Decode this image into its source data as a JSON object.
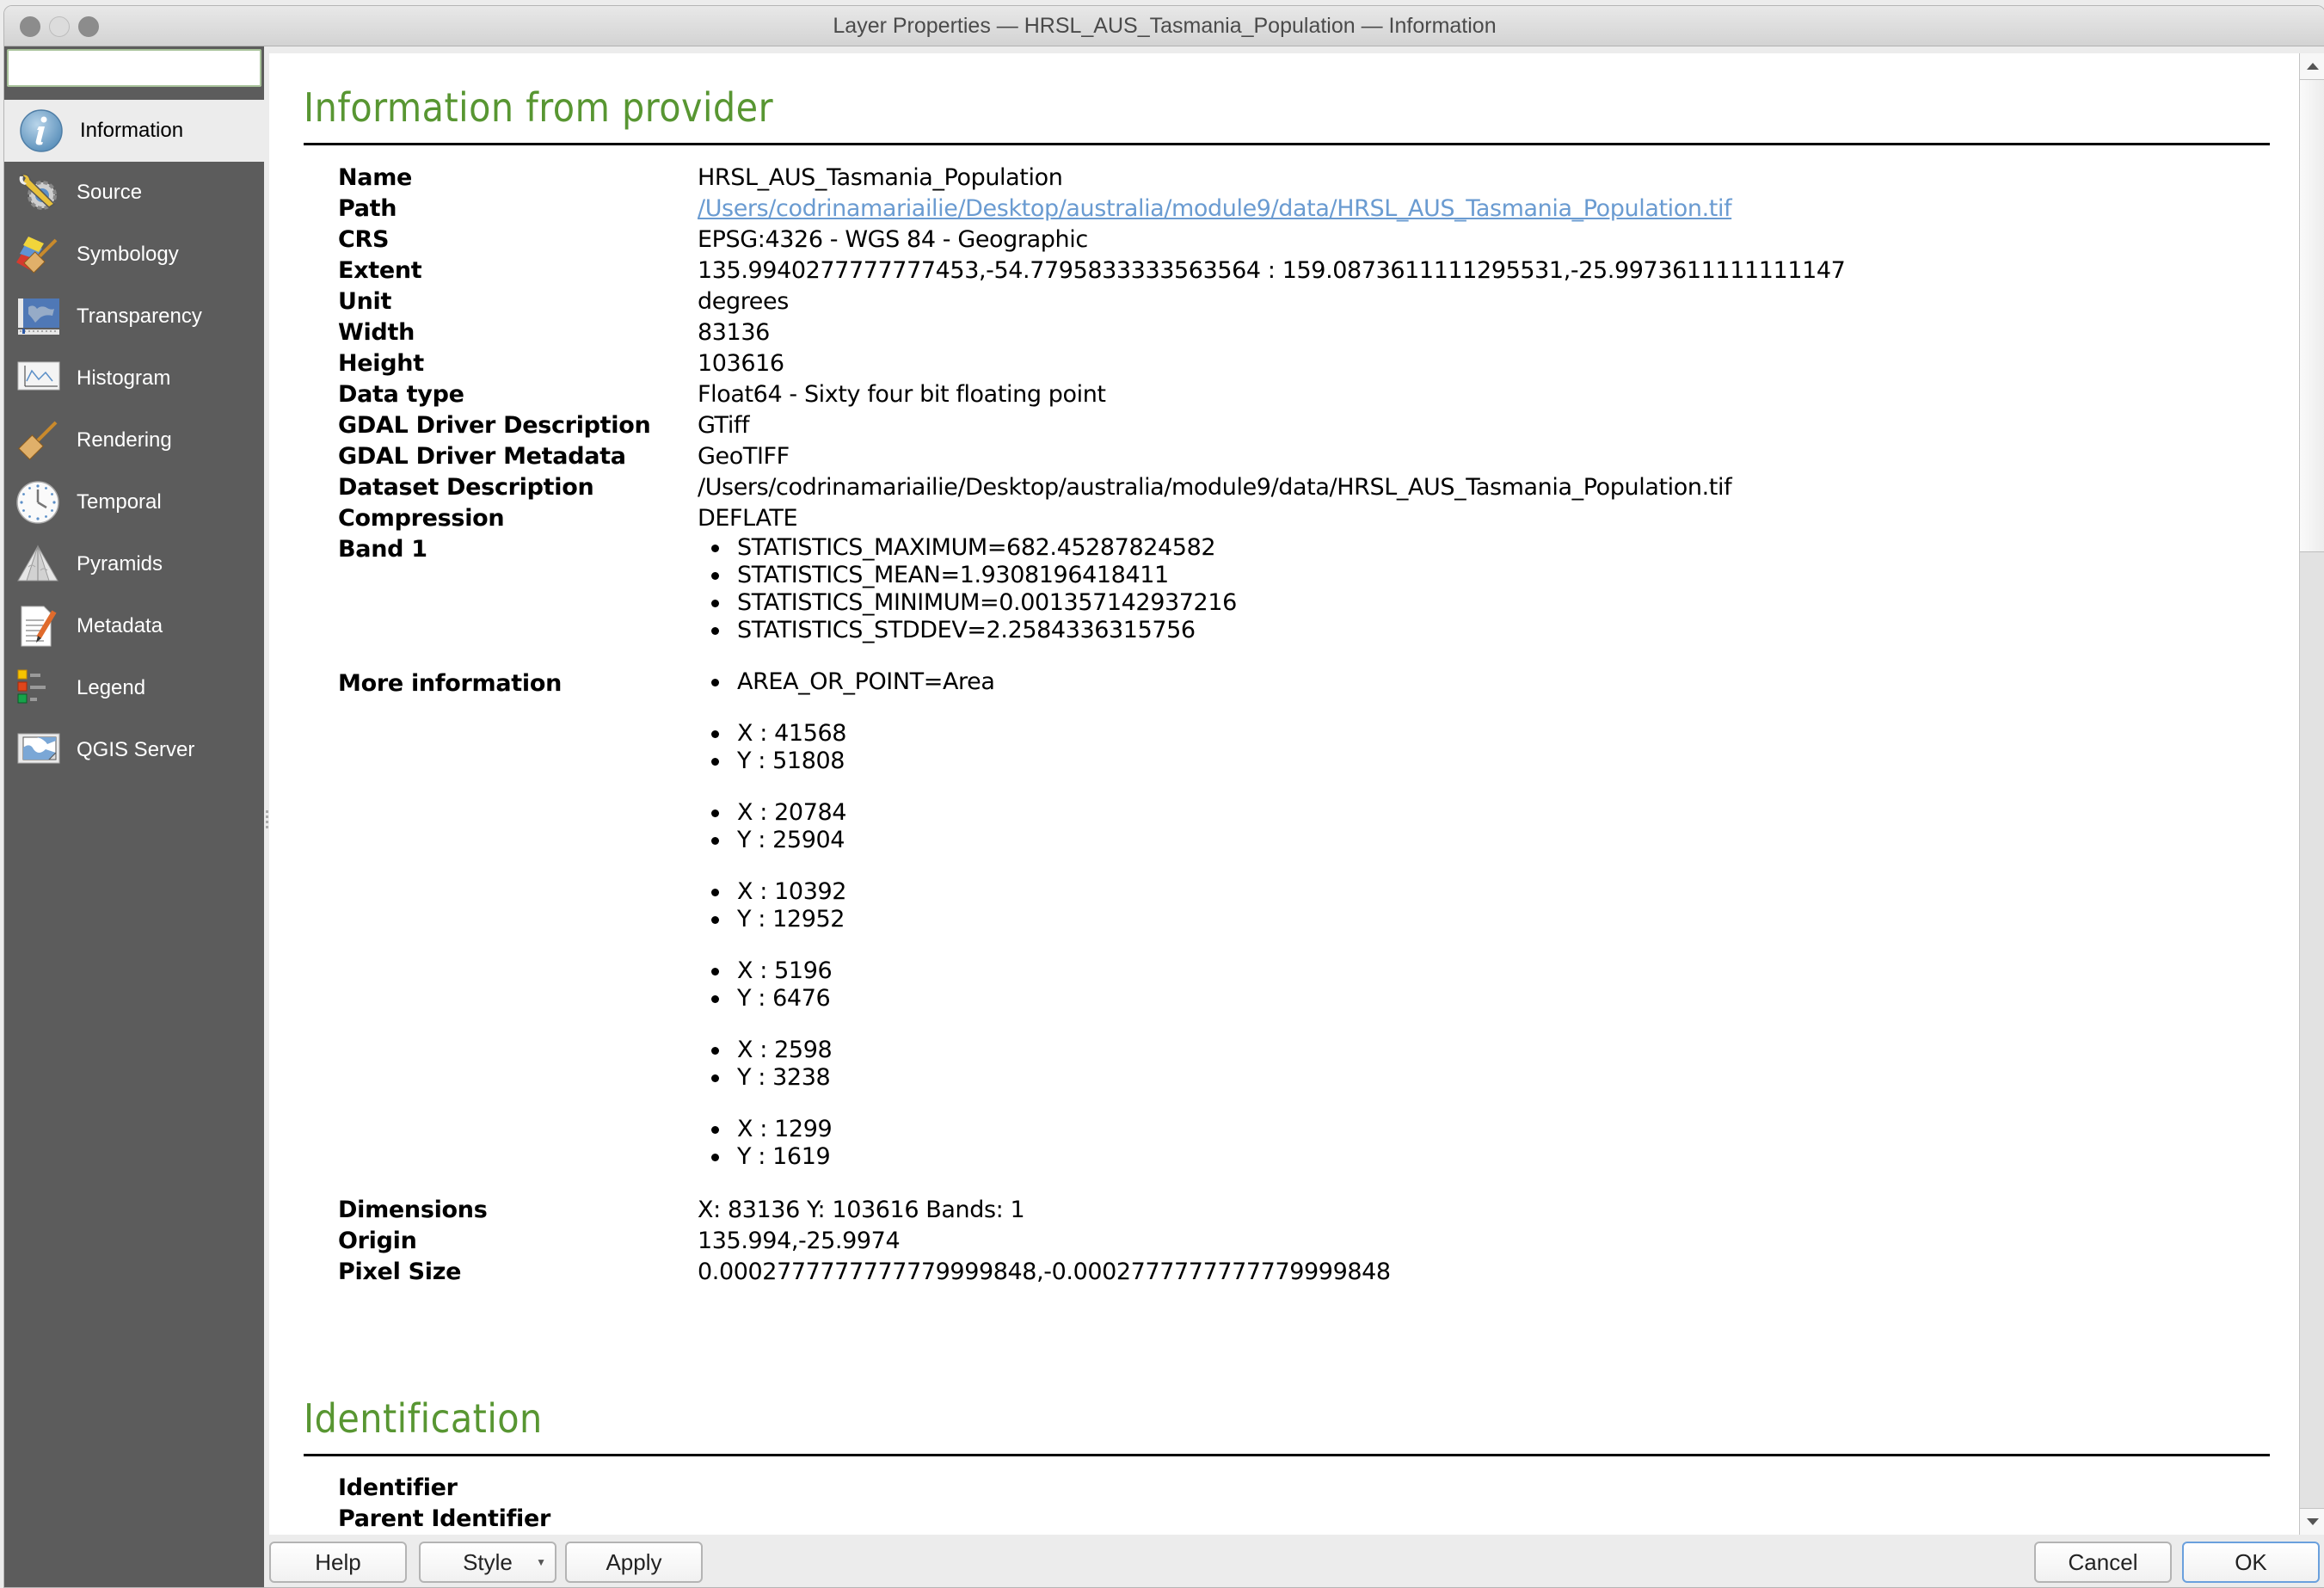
{
  "window": {
    "title": "Layer Properties — HRSL_AUS_Tasmania_Population — Information"
  },
  "search": {
    "value": "",
    "placeholder": "",
    "icon": "search-icon"
  },
  "sidebar": {
    "items": [
      {
        "label": "Information",
        "icon": "info-icon",
        "active": true
      },
      {
        "label": "Source",
        "icon": "wrench-gear-icon"
      },
      {
        "label": "Symbology",
        "icon": "paintbrush-icon"
      },
      {
        "label": "Transparency",
        "icon": "map-transparency-icon"
      },
      {
        "label": "Histogram",
        "icon": "histogram-icon"
      },
      {
        "label": "Rendering",
        "icon": "broom-brush-icon"
      },
      {
        "label": "Temporal",
        "icon": "clock-icon"
      },
      {
        "label": "Pyramids",
        "icon": "pyramid-icon"
      },
      {
        "label": "Metadata",
        "icon": "document-pencil-icon"
      },
      {
        "label": "Legend",
        "icon": "legend-icon"
      },
      {
        "label": "QGIS Server",
        "icon": "server-map-icon"
      }
    ]
  },
  "info": {
    "section_title": "Information from provider",
    "rows": [
      {
        "key": "Name",
        "value": "HRSL_AUS_Tasmania_Population"
      },
      {
        "key": "Path",
        "value": "/Users/codrinamariailie/Desktop/australia/module9/data/HRSL_AUS_Tasmania_Population.tif",
        "link": true
      },
      {
        "key": "CRS",
        "value": "EPSG:4326 - WGS 84 - Geographic"
      },
      {
        "key": "Extent",
        "value": "135.9940277777777453,-54.7795833333563564 : 159.0873611111295531,-25.9973611111111147"
      },
      {
        "key": "Unit",
        "value": "degrees"
      },
      {
        "key": "Width",
        "value": "83136"
      },
      {
        "key": "Height",
        "value": "103616"
      },
      {
        "key": "Data type",
        "value": "Float64 - Sixty four bit floating point"
      },
      {
        "key": "GDAL Driver Description",
        "value": "GTiff"
      },
      {
        "key": "GDAL Driver Metadata",
        "value": "GeoTIFF"
      },
      {
        "key": "Dataset Description",
        "value": "/Users/codrinamariailie/Desktop/australia/module9/data/HRSL_AUS_Tasmania_Population.tif"
      },
      {
        "key": "Compression",
        "value": "DEFLATE"
      }
    ],
    "band": {
      "key": "Band 1",
      "items": [
        "STATISTICS_MAXIMUM=682.45287824582",
        "STATISTICS_MEAN=1.9308196418411",
        "STATISTICS_MINIMUM=0.001357142937216",
        "STATISTICS_STDDEV=2.2584336315756"
      ]
    },
    "more_information": {
      "key": "More information",
      "groups": [
        [
          "AREA_OR_POINT=Area"
        ],
        [
          "X : 41568",
          "Y : 51808"
        ],
        [
          "X : 20784",
          "Y : 25904"
        ],
        [
          "X : 10392",
          "Y : 12952"
        ],
        [
          "X : 5196",
          "Y : 6476"
        ],
        [
          "X : 2598",
          "Y : 3238"
        ],
        [
          "X : 1299",
          "Y : 1619"
        ]
      ]
    },
    "tail_rows": [
      {
        "key": "Dimensions",
        "value": "X: 83136 Y: 103616 Bands: 1"
      },
      {
        "key": "Origin",
        "value": "135.994,-25.9974"
      },
      {
        "key": "Pixel Size",
        "value": "0.0002777777777779999848,-0.0002777777777779999848"
      }
    ]
  },
  "identification": {
    "section_title": "Identification",
    "rows": [
      {
        "key": "Identifier",
        "value": ""
      },
      {
        "key": "Parent Identifier",
        "value": ""
      }
    ]
  },
  "scroll": {
    "position_fraction": 0.0,
    "visible_fraction": 0.33
  },
  "buttons": {
    "help": "Help",
    "style": "Style",
    "apply": "Apply",
    "cancel": "Cancel",
    "ok": "OK"
  },
  "colors": {
    "section_title": "#589632",
    "link": "#6a9bd1",
    "sidebar_bg": "#5c5c5c",
    "sidebar_active_bg": "#ececec"
  }
}
